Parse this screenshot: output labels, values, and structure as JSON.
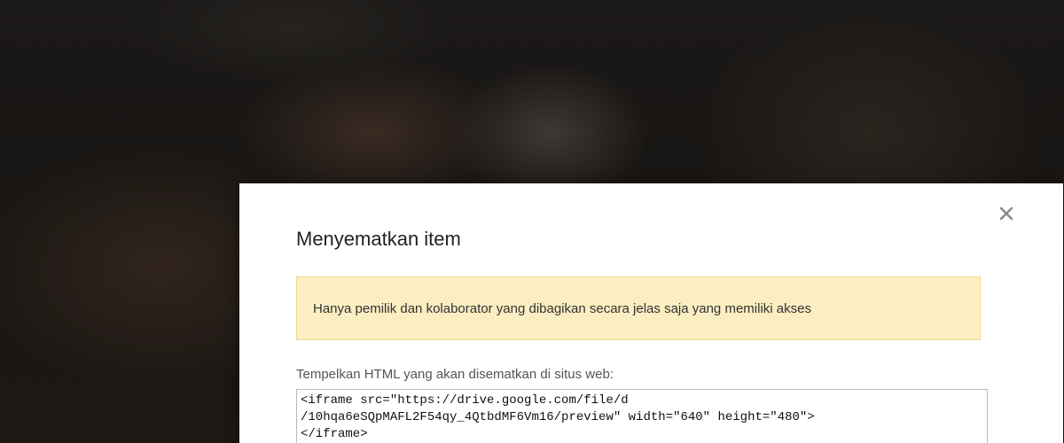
{
  "dialog": {
    "title": "Menyematkan item",
    "close_icon": "close-icon",
    "notice": "Hanya pemilik dan kolaborator yang dibagikan secara jelas saja yang memiliki akses",
    "embed_label": "Tempelkan HTML yang akan disematkan di situs web:",
    "embed_code": "<iframe src=\"https://drive.google.com/file/d\n/10hqa6eSQpMAFL2F54qy_4QtbdMF6Vm16/preview\" width=\"640\" height=\"480\">\n</iframe>"
  },
  "colors": {
    "notice_background": "#fbeec2",
    "notice_border": "#f0d98c",
    "overlay": "#000000"
  }
}
